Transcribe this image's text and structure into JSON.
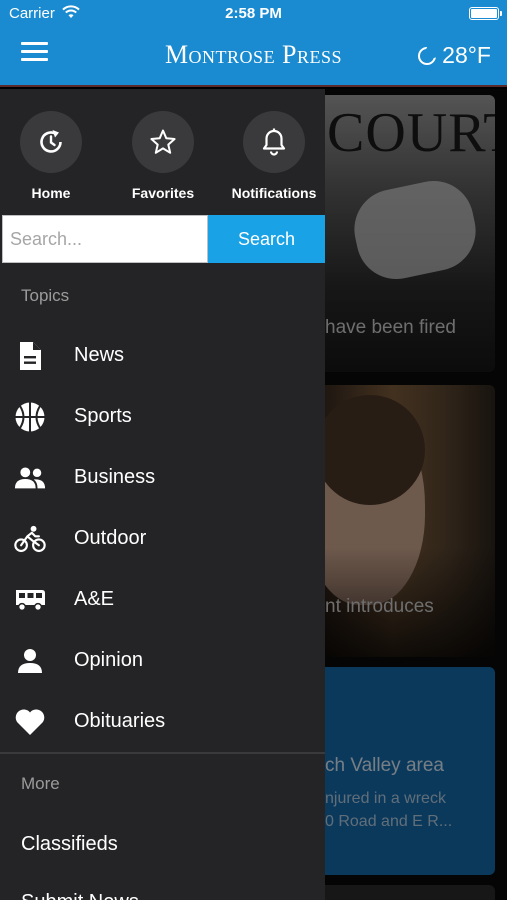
{
  "status_bar": {
    "carrier": "Carrier",
    "time": "2:58 PM"
  },
  "header": {
    "brand": "Montrose Press",
    "temperature": "28°F",
    "weather_icon": "moon-icon"
  },
  "quick_actions": [
    {
      "label": "Home",
      "icon": "home-refresh-icon"
    },
    {
      "label": "Favorites",
      "icon": "star-icon"
    },
    {
      "label": "Notifications",
      "icon": "bell-icon"
    }
  ],
  "search": {
    "placeholder": "Search...",
    "value": "",
    "button_label": "Search"
  },
  "topics": {
    "title": "Topics",
    "items": [
      {
        "label": "News",
        "icon": "document-icon"
      },
      {
        "label": "Sports",
        "icon": "basketball-icon"
      },
      {
        "label": "Business",
        "icon": "people-icon"
      },
      {
        "label": "Outdoor",
        "icon": "bicycle-icon"
      },
      {
        "label": "A&E",
        "icon": "rv-icon"
      },
      {
        "label": "Opinion",
        "icon": "person-icon"
      },
      {
        "label": "Obituaries",
        "icon": "heart-icon"
      }
    ]
  },
  "more": {
    "title": "More",
    "items": [
      {
        "label": "Classifieds"
      },
      {
        "label": "Submit News"
      }
    ]
  },
  "background_articles": {
    "card1_headline": "COURTS",
    "card1_caption": "have been fired",
    "card2_caption": "nt introduces",
    "card3_caption": "ch Valley area",
    "card3_sub1": "njured in a wreck",
    "card3_sub2": "0 Road and E R..."
  },
  "colors": {
    "header_bg": "#1a8bd0",
    "drawer_bg": "#242426",
    "search_button": "#1aa2e6"
  }
}
